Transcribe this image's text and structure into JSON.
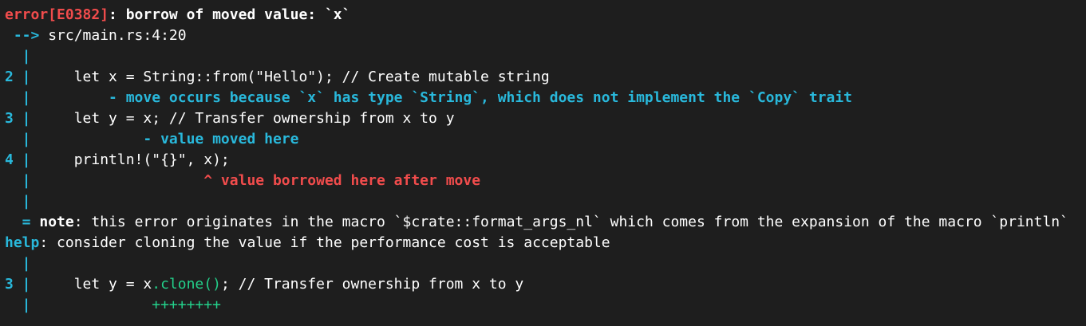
{
  "colors": {
    "background": "#1e1e1e",
    "text": "#ffffff",
    "error": "#f14c4c",
    "info": "#29b8db",
    "note": "#ffffff",
    "added": "#23d18b"
  },
  "lines": [
    {
      "spans": [
        {
          "text": "error[E0382]",
          "color": "error",
          "bold": true
        },
        {
          "text": ": borrow of moved value: `x`",
          "color": "text",
          "bold": true
        }
      ]
    },
    {
      "spans": [
        {
          "text": " --> ",
          "color": "info",
          "bold": true
        },
        {
          "text": "src/main.rs:4:20",
          "color": "text",
          "bold": false
        }
      ]
    },
    {
      "spans": [
        {
          "text": "  |",
          "color": "info",
          "bold": true
        }
      ]
    },
    {
      "spans": [
        {
          "text": "2 |",
          "color": "info",
          "bold": true
        },
        {
          "text": "     let x = String::from(\"Hello\"); // Create mutable string",
          "color": "text",
          "bold": false
        }
      ]
    },
    {
      "spans": [
        {
          "text": "  |",
          "color": "info",
          "bold": true
        },
        {
          "text": "         - move occurs because `x` has type `String`, which does not implement the `Copy` trait",
          "color": "info",
          "bold": true
        }
      ]
    },
    {
      "spans": [
        {
          "text": "3 |",
          "color": "info",
          "bold": true
        },
        {
          "text": "     let y = x; // Transfer ownership from x to y",
          "color": "text",
          "bold": false
        }
      ]
    },
    {
      "spans": [
        {
          "text": "  |",
          "color": "info",
          "bold": true
        },
        {
          "text": "             - value moved here",
          "color": "info",
          "bold": true
        }
      ]
    },
    {
      "spans": [
        {
          "text": "4 |",
          "color": "info",
          "bold": true
        },
        {
          "text": "     println!(\"{}\", x);",
          "color": "text",
          "bold": false
        }
      ]
    },
    {
      "spans": [
        {
          "text": "  |",
          "color": "info",
          "bold": true
        },
        {
          "text": "                    ^ value borrowed here after move",
          "color": "error",
          "bold": true
        }
      ]
    },
    {
      "spans": [
        {
          "text": "  |",
          "color": "info",
          "bold": true
        }
      ]
    },
    {
      "spans": [
        {
          "text": "  = ",
          "color": "info",
          "bold": true
        },
        {
          "text": "note",
          "color": "note",
          "bold": true
        },
        {
          "text": ": this error originates in the macro `$crate::format_args_nl` which comes from the expansion of the macro `println`",
          "color": "text",
          "bold": false
        }
      ]
    },
    {
      "spans": [
        {
          "text": "help",
          "color": "info",
          "bold": true
        },
        {
          "text": ": consider cloning the value if the performance cost is acceptable",
          "color": "text",
          "bold": false
        }
      ]
    },
    {
      "spans": [
        {
          "text": "  |",
          "color": "info",
          "bold": true
        }
      ]
    },
    {
      "spans": [
        {
          "text": "3 |",
          "color": "info",
          "bold": true
        },
        {
          "text": "     let y = x",
          "color": "text",
          "bold": false
        },
        {
          "text": ".clone()",
          "color": "added",
          "bold": false
        },
        {
          "text": "; // Transfer ownership from x to y",
          "color": "text",
          "bold": false
        }
      ]
    },
    {
      "spans": [
        {
          "text": "  |",
          "color": "info",
          "bold": true
        },
        {
          "text": "              ++++++++",
          "color": "added",
          "bold": false
        }
      ]
    }
  ]
}
